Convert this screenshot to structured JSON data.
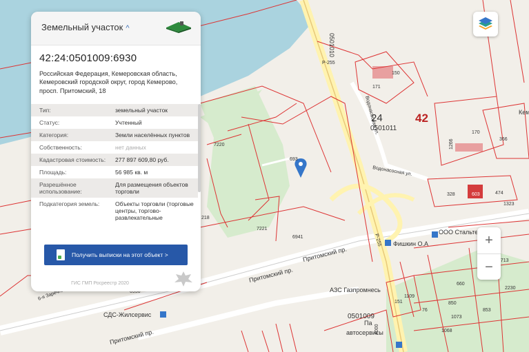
{
  "panel": {
    "title": "Земельный участок",
    "cadastral_number": "42:24:0501009:6930",
    "address": "Российская Федерация, Кемеровская область, Кемеровский городской округ, город Кемерово, просп. Притомский, 18",
    "rows": [
      {
        "key": "Тип:",
        "value": "земельный участок"
      },
      {
        "key": "Статус:",
        "value": "Учтенный"
      },
      {
        "key": "Категория:",
        "value": "Земли населённых пунктов"
      },
      {
        "key": "Собственность:",
        "value": "нет данных"
      },
      {
        "key": "Кадастровая стоимость:",
        "value": "277 897 609,80 руб."
      },
      {
        "key": "Площадь:",
        "value": "56 985 кв. м"
      },
      {
        "key": "Разрешённое использование:",
        "value": "Для размещения объектов торговли"
      },
      {
        "key": "Подкатегория земель:",
        "value": "Объекты торговли (торговые центры, торгово-развлекательные"
      }
    ],
    "button_label": "Получить выписки на этот объект >",
    "footer": "ГИС ГМП Росреестр 2020"
  },
  "controls": {
    "zoom_in": "+",
    "zoom_out": "−"
  },
  "map": {
    "labels": {
      "q1": "0501010",
      "q2": "24",
      "q3": "0501011",
      "q4": "42",
      "q5": "0501009",
      "road": "Р-255",
      "road2": "Р-255",
      "p150": "150",
      "p171": "171",
      "p170": "170",
      "p1266": "1266",
      "p366": "366",
      "p328": "328",
      "p603": "603",
      "p474": "474",
      "p1323": "1323",
      "p7220": "7220",
      "p7221": "7221",
      "p6941": "6941",
      "p6936": "6936",
      "p693": "693",
      "p218": "218",
      "p2713": "2713",
      "p2230": "2230",
      "p660": "660",
      "p850": "850",
      "p853": "853",
      "p1073": "1073",
      "p1068": "1068",
      "p4000": "4000",
      "p1109": "1109",
      "p151": "151",
      "p76": "76",
      "street1": "Притомский пр.",
      "street2": "Притомский пр.",
      "street3": "Притомский пр.",
      "street4": "Водонасосная ул.",
      "street5": "Водонасосная ул.",
      "street6": "6-я Заречная",
      "poi1": "ООО Стальте",
      "poi2": "Фишкин О.А",
      "poi3": "АЗС Газпромнесь",
      "poi4": "СДС-Жилсервис",
      "poi5": "Па",
      "poi6": "автосервисы",
      "poi7": "Кем"
    },
    "colors": {
      "water": "#aad3df",
      "land": "#f2efe9",
      "green": "#d6ebcd",
      "boundary": "#d33",
      "road": "#fff3b0"
    }
  }
}
